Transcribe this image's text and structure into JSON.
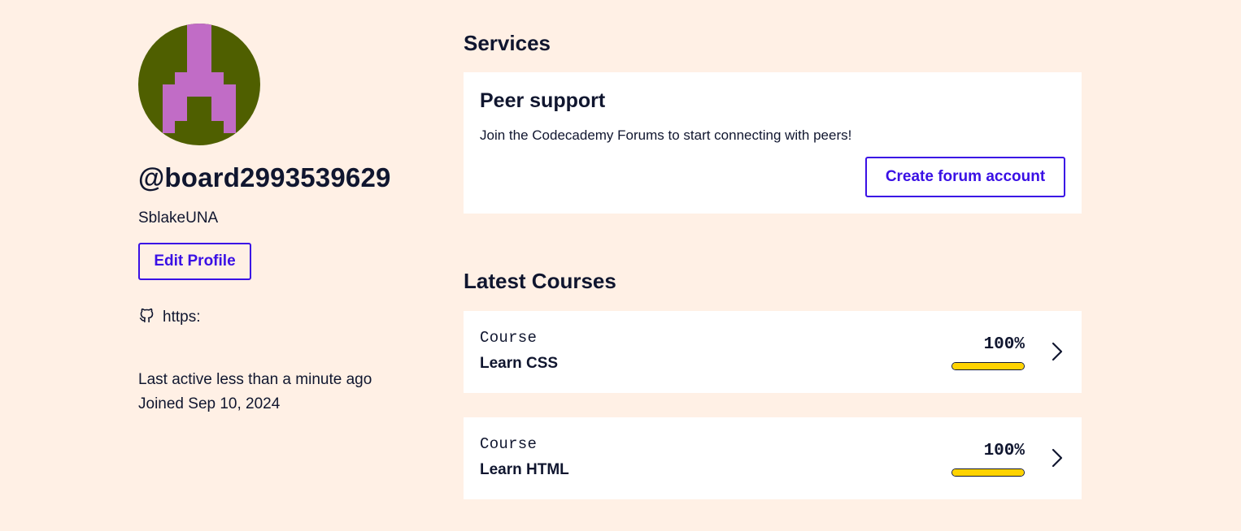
{
  "profile": {
    "username": "@board2993539629",
    "display_name": "SblakeUNA",
    "edit_label": "Edit Profile",
    "website_text": "https:",
    "last_active": "Last active less than a minute ago",
    "joined": "Joined Sep 10, 2024",
    "avatar_colors": {
      "background": "#4f5f00",
      "figure": "#c16cc6"
    }
  },
  "services": {
    "title": "Services",
    "peer": {
      "title": "Peer support",
      "description": "Join the Codecademy Forums to start connecting with peers!",
      "button_label": "Create forum account"
    }
  },
  "courses": {
    "title": "Latest Courses",
    "items": [
      {
        "kind": "Course",
        "name": "Learn CSS",
        "percent_label": "100%",
        "progress": 1.0
      },
      {
        "kind": "Course",
        "name": "Learn HTML",
        "percent_label": "100%",
        "progress": 1.0
      }
    ]
  },
  "colors": {
    "page_background": "#fff0e5",
    "text": "#10162f",
    "accent": "#3a10e5",
    "progress_fill": "#ffd300",
    "card_background": "#ffffff"
  },
  "icons": {
    "website": "github-icon",
    "course_open": "chevron-right-icon"
  }
}
